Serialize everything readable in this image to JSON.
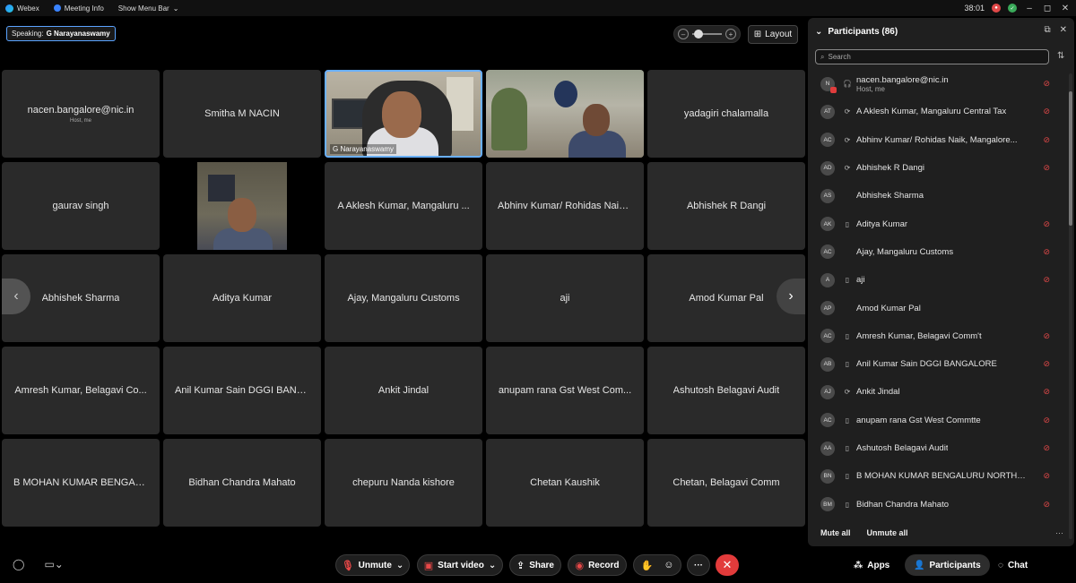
{
  "titlebar": {
    "app_name": "Webex",
    "meeting_info": "Meeting Info",
    "menu_bar": "Show Menu Bar",
    "timer": "38:01",
    "window_controls": [
      "–",
      "◻",
      "✕"
    ]
  },
  "toolbar_top": {
    "speaking_label": "Speaking:",
    "speaking_name": "G Narayanaswamy",
    "layout_label": "Layout"
  },
  "tiles": [
    {
      "name": "nacen.bangalore@nic.in",
      "sub": "Host, me",
      "type": "name"
    },
    {
      "name": "Smitha M NACIN",
      "type": "name"
    },
    {
      "name": "G Narayanaswamy",
      "type": "video1"
    },
    {
      "name": "",
      "type": "video2"
    },
    {
      "name": "yadagiri chalamalla",
      "type": "name"
    },
    {
      "name": "gaurav singh",
      "type": "name"
    },
    {
      "name": "",
      "type": "video3"
    },
    {
      "name": "A Aklesh Kumar, Mangaluru ...",
      "type": "name"
    },
    {
      "name": "Abhinv Kumar/ Rohidas Naik,...",
      "type": "name"
    },
    {
      "name": "Abhishek R Dangi",
      "type": "name"
    },
    {
      "name": "Abhishek Sharma",
      "type": "name"
    },
    {
      "name": "Aditya Kumar",
      "type": "name"
    },
    {
      "name": "Ajay, Mangaluru Customs",
      "type": "name"
    },
    {
      "name": "aji",
      "type": "name"
    },
    {
      "name": "Amod Kumar Pal",
      "type": "name"
    },
    {
      "name": "Amresh Kumar, Belagavi Co...",
      "type": "name"
    },
    {
      "name": "Anil Kumar Sain DGGI BANG...",
      "type": "name"
    },
    {
      "name": "Ankit Jindal",
      "type": "name"
    },
    {
      "name": "anupam rana Gst West Com...",
      "type": "name"
    },
    {
      "name": "Ashutosh Belagavi Audit",
      "type": "name"
    },
    {
      "name": "B MOHAN KUMAR BENGALU...",
      "type": "name"
    },
    {
      "name": "Bidhan Chandra Mahato",
      "type": "name"
    },
    {
      "name": "chepuru Nanda kishore",
      "type": "name"
    },
    {
      "name": "Chetan Kaushik",
      "type": "name"
    },
    {
      "name": "Chetan, Belagavi Comm",
      "type": "name"
    }
  ],
  "participants_panel": {
    "title": "Participants (86)",
    "search_placeholder": "Search",
    "mute_all": "Mute all",
    "unmute_all": "Unmute all",
    "participants": [
      {
        "initials": "N",
        "name": "nacen.bangalore@nic.in",
        "sub": "Host, me",
        "device": "headset",
        "muted": true,
        "host": true
      },
      {
        "initials": "AT",
        "name": "A Aklesh Kumar, Mangaluru Central Tax",
        "device": "sync",
        "muted": true
      },
      {
        "initials": "AC",
        "name": "Abhinv Kumar/ Rohidas Naik, Mangalore...",
        "device": "sync",
        "muted": true
      },
      {
        "initials": "AD",
        "name": "Abhishek R Dangi",
        "device": "sync",
        "muted": true
      },
      {
        "initials": "AS",
        "name": "Abhishek Sharma",
        "device": "",
        "muted": false
      },
      {
        "initials": "AK",
        "name": "Aditya Kumar",
        "device": "phone",
        "muted": true
      },
      {
        "initials": "AC",
        "name": "Ajay, Mangaluru Customs",
        "device": "",
        "muted": true
      },
      {
        "initials": "A",
        "name": "aji",
        "device": "phone",
        "muted": true
      },
      {
        "initials": "AP",
        "name": "Amod Kumar Pal",
        "device": "",
        "muted": false
      },
      {
        "initials": "AC",
        "name": "Amresh Kumar, Belagavi Comm't",
        "device": "phone",
        "muted": true
      },
      {
        "initials": "AB",
        "name": "Anil Kumar Sain DGGI BANGALORE",
        "device": "phone",
        "muted": true
      },
      {
        "initials": "AJ",
        "name": "Ankit Jindal",
        "device": "sync",
        "muted": true
      },
      {
        "initials": "AC",
        "name": "anupam rana Gst West Commtte",
        "device": "phone",
        "muted": true
      },
      {
        "initials": "AA",
        "name": "Ashutosh Belagavi Audit",
        "device": "phone",
        "muted": true
      },
      {
        "initials": "BN",
        "name": "B MOHAN KUMAR BENGALURU NORTH-...",
        "device": "phone",
        "muted": true
      },
      {
        "initials": "BM",
        "name": "Bidhan Chandra Mahato",
        "device": "phone",
        "muted": true
      }
    ]
  },
  "bottom_bar": {
    "unmute": "Unmute",
    "start_video": "Start video",
    "share": "Share",
    "record": "Record",
    "apps": "Apps",
    "participants": "Participants",
    "chat": "Chat"
  },
  "colors": {
    "accent": "#6ab0ff",
    "mute_red": "#e04848",
    "end_red": "#e23b3b",
    "tile_bg": "#2a2a2a",
    "panel_bg": "#1f1f1f"
  }
}
